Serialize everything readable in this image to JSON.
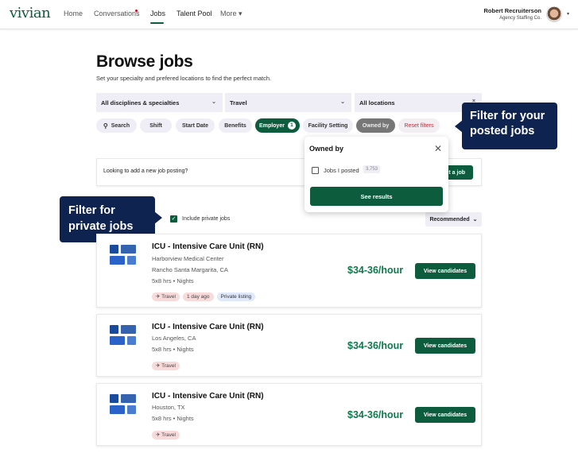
{
  "nav": {
    "logo": "vivian",
    "links": [
      "Home",
      "Conversations",
      "Jobs",
      "Talent Pool",
      "More ▾"
    ],
    "active": "Jobs",
    "user_name": "Robert Recruiterson",
    "user_company": "Agency Staffing Co.",
    "user_caret": "▾"
  },
  "page": {
    "title": "Browse jobs",
    "subtitle": "Set your specialty and prefered locations to find the perfect match."
  },
  "selects": [
    {
      "value": "All disciplines & specialties",
      "icon": "chevron-down-icon"
    },
    {
      "value": "Travel",
      "icon": "chevron-down-icon"
    },
    {
      "value": "All locations",
      "icon": "close-icon"
    }
  ],
  "chips": {
    "search": "Search",
    "shift": "Shift",
    "start_date": "Start Date",
    "benefits": "Benefits",
    "employer": "Employer",
    "employer_count": "1",
    "facility_setting": "Facility Setting",
    "owned_by": "Owned by",
    "reset": "Reset filters"
  },
  "callouts": {
    "posted": "Filter for your posted jobs",
    "private": "Filter for private jobs"
  },
  "post_card": {
    "text": "Looking to add a new job posting?",
    "button": "Post a job"
  },
  "owned_popover": {
    "title": "Owned by",
    "option_label": "Jobs I posted",
    "option_count": "3,753",
    "option_checked": false,
    "button": "See results"
  },
  "private_jobs": {
    "label": "Include private jobs",
    "checked": true
  },
  "sort": {
    "value": "Recommended",
    "icon": "chevron-down-icon"
  },
  "jobs": [
    {
      "title": "ICU - Intensive Care Unit (RN)",
      "facility": "Harborview Medical Center",
      "location": "Rancho Santa Margarita, CA",
      "schedule": "5x8 hrs • Nights",
      "tags": [
        "✈ Travel",
        "1 day ago",
        "Private listing"
      ],
      "price": "$34-36/hour",
      "button": "View candidates"
    },
    {
      "title": "ICU - Intensive Care Unit (RN)",
      "location": "Los Angeles, CA",
      "schedule": "5x8 hrs • Nights",
      "tags": [
        "✈ Travel"
      ],
      "price": "$34-36/hour",
      "button": "View candidates"
    },
    {
      "title": "ICU - Intensive Care Unit (RN)",
      "location": "Houston, TX",
      "schedule": "5x8 hrs • Nights",
      "tags": [
        "✈ Travel"
      ],
      "price": "$34-36/hour",
      "button": "View candidates"
    }
  ],
  "colors": {
    "brand_green": "#0d5c3d",
    "price_green": "#0d7a4c",
    "callout_navy": "#0f2350",
    "alert_red": "#c62d3d"
  }
}
